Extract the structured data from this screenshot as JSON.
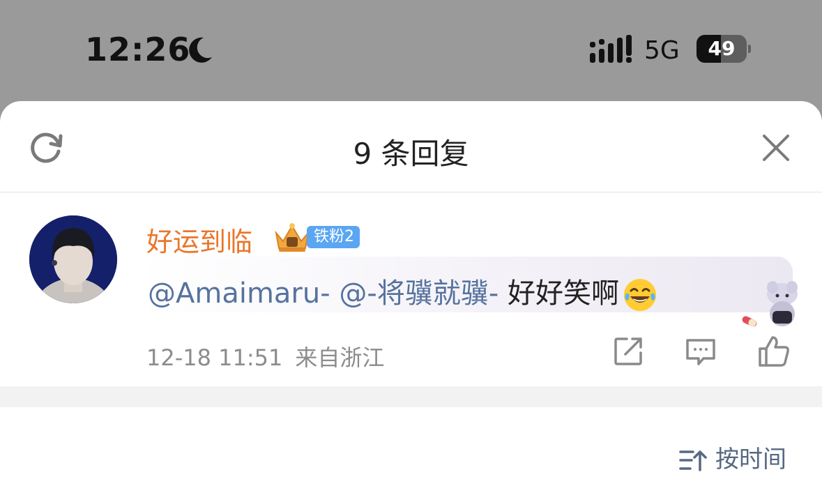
{
  "status_bar": {
    "time": "12:26",
    "network": "5G",
    "battery_level": "49",
    "battery_fraction": 0.49,
    "icons": [
      "moon-icon",
      "signal-icon",
      "battery-icon"
    ]
  },
  "header": {
    "title": "9 条回复",
    "refresh_icon": "refresh-icon",
    "close_icon": "close-icon"
  },
  "comment": {
    "username": "好运到临",
    "badge_icon": "crown-icon",
    "fan_badge": "铁粉2",
    "mention_1": "@Amaimaru-",
    "mention_2": "@-将骥就骥-",
    "text": "好好笑啊",
    "emoji": "laughing-tears-emoji",
    "timestamp": "12-18 11:51",
    "location": "来自浙江",
    "actions": [
      "share-icon",
      "reply-icon",
      "like-icon"
    ]
  },
  "sort": {
    "label": "按时间",
    "icon": "sort-icon"
  },
  "colors": {
    "username": "#e9772b",
    "mention": "#56739e",
    "fan_badge": "#5aa6f2",
    "meta": "#8c8c8c",
    "status_bg": "#9a9a9a"
  }
}
